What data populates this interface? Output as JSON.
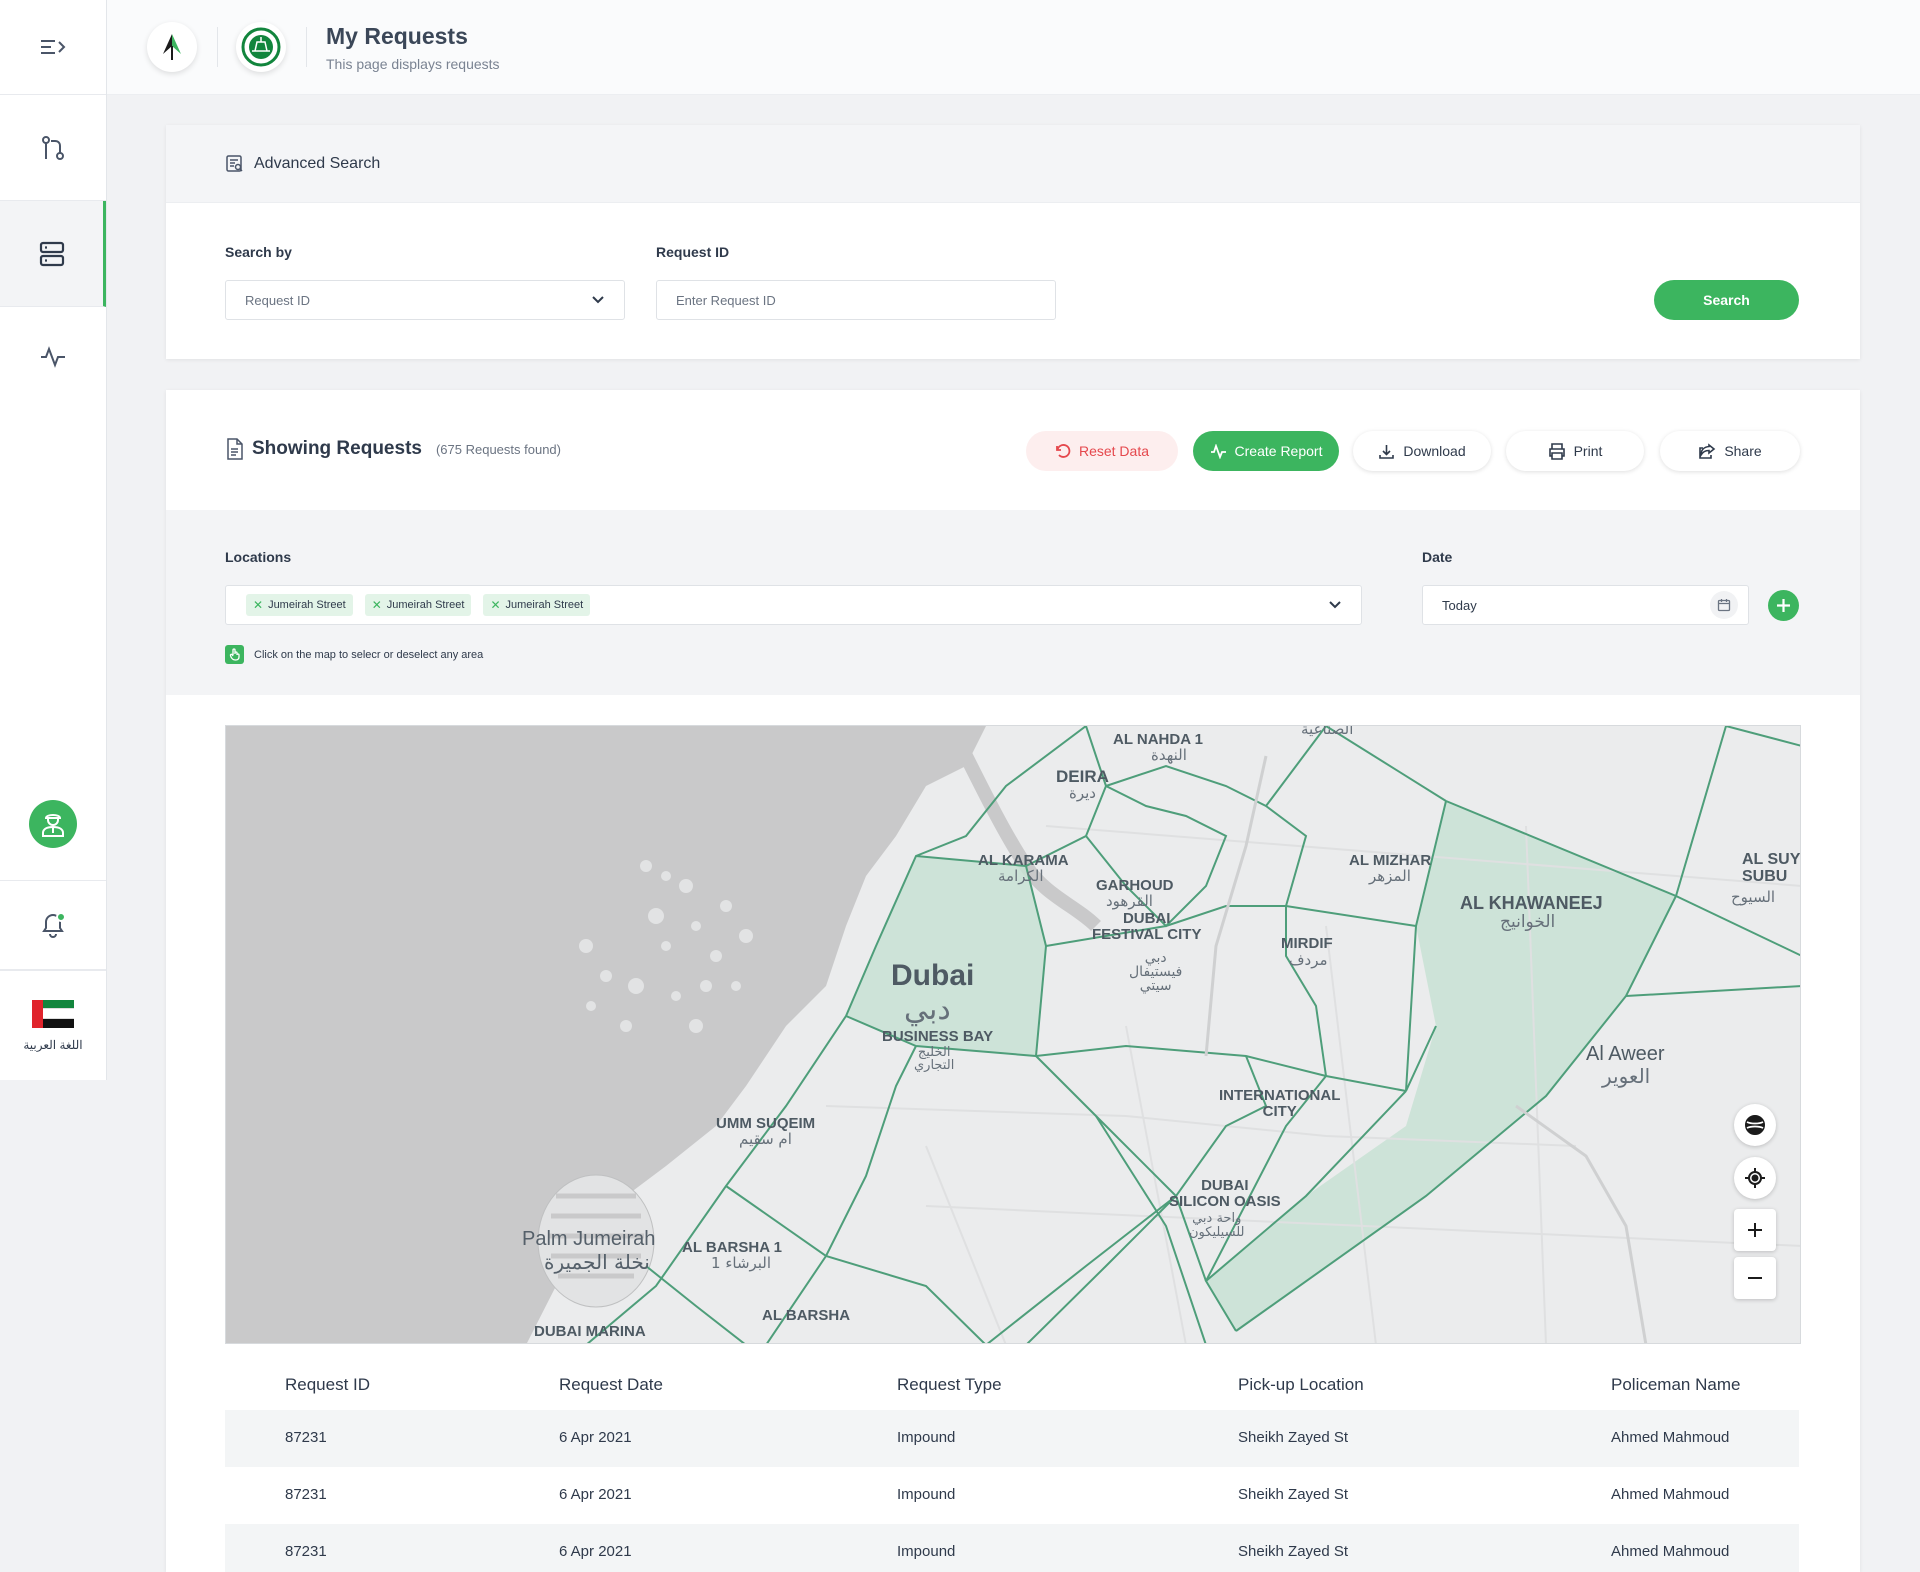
{
  "header": {
    "title": "My Requests",
    "subtitle": "This page displays requests"
  },
  "sidebar": {
    "language_label": "اللغة العربية"
  },
  "advanced_search": {
    "title": "Advanced Search",
    "search_by_label": "Search by",
    "search_by_value": "Request ID",
    "request_id_label": "Request ID",
    "request_id_placeholder": "Enter Request ID",
    "search_button": "Search"
  },
  "results": {
    "title": "Showing Requests",
    "count": "(675 Requests found)",
    "actions": {
      "reset": "Reset Data",
      "create_report": "Create Report",
      "download": "Download",
      "print": "Print",
      "share": "Share"
    },
    "filters": {
      "locations_label": "Locations",
      "locations": [
        "Jumeirah Street",
        "Jumeirah Street",
        "Jumeirah Street"
      ],
      "date_label": "Date",
      "date_value": "Today",
      "hint": "Click on the map to selecr or deselect any area"
    }
  },
  "map": {
    "labels": {
      "al_nahda": "AL NAHDA 1",
      "al_nahda_ar": "النهدة",
      "deira": "DEIRA",
      "deira_ar": "ديرة",
      "al_karama": "AL KARAMA",
      "al_karama_ar": "الكرامة",
      "garhoud": "GARHOUD",
      "garhoud_ar": "القرهود",
      "festival": "DUBAI\nFESTIVAL CITY",
      "festival_ar": "دبي\nفيستيفال\nسيتي",
      "dubai": "Dubai",
      "dubai_ar": "دبي",
      "business_bay": "BUSINESS BAY",
      "business_bay_ar": "الخليج\nالتجاري",
      "al_mizhar": "AL MIZHAR",
      "al_mizhar_ar": "المزهر",
      "al_khawaneej": "AL KHAWANEEJ",
      "al_khawaneej_ar": "الخوانيج",
      "mirdif": "MIRDIF",
      "mirdif_ar": "مردف",
      "al_suyoh": "AL SUY\nSUBU",
      "al_suyoh_ar": "السيوح",
      "al_aweer": "Al Aweer",
      "al_aweer_ar": "العوير",
      "international_city": "INTERNATIONAL\nCITY",
      "umm_suqeim": "UMM SUQEIM",
      "umm_suqeim_ar": "ام سقيم",
      "silicon_oasis": "DUBAI\nSILICON OASIS",
      "silicon_oasis_ar": "واحة دبي\nللسيليكون",
      "palm": "Palm Jumeirah",
      "palm_ar": "نخلة الجميرة",
      "al_barsha_1": "AL BARSHA 1",
      "al_barsha_1_ar": "البرشاء 1",
      "al_barsha": "AL BARSHA",
      "dubai_marina": "DUBAI MARINA",
      "top_ar": "الصناعية"
    }
  },
  "table": {
    "headers": [
      "Request ID",
      "Request Date",
      "Request Type",
      "Pick-up Location",
      "Policeman Name"
    ],
    "rows": [
      [
        "87231",
        "6 Apr 2021",
        "Impound",
        "Sheikh Zayed St",
        "Ahmed Mahmoud"
      ],
      [
        "87231",
        "6 Apr 2021",
        "Impound",
        "Sheikh Zayed St",
        "Ahmed Mahmoud"
      ],
      [
        "87231",
        "6 Apr 2021",
        "Impound",
        "Sheikh Zayed St",
        "Ahmed Mahmoud"
      ]
    ]
  },
  "colors": {
    "accent": "#3cb55f",
    "danger": "#e5484d",
    "zone_fill": "#c8e2d4",
    "zone_stroke": "#4e9e7a"
  }
}
